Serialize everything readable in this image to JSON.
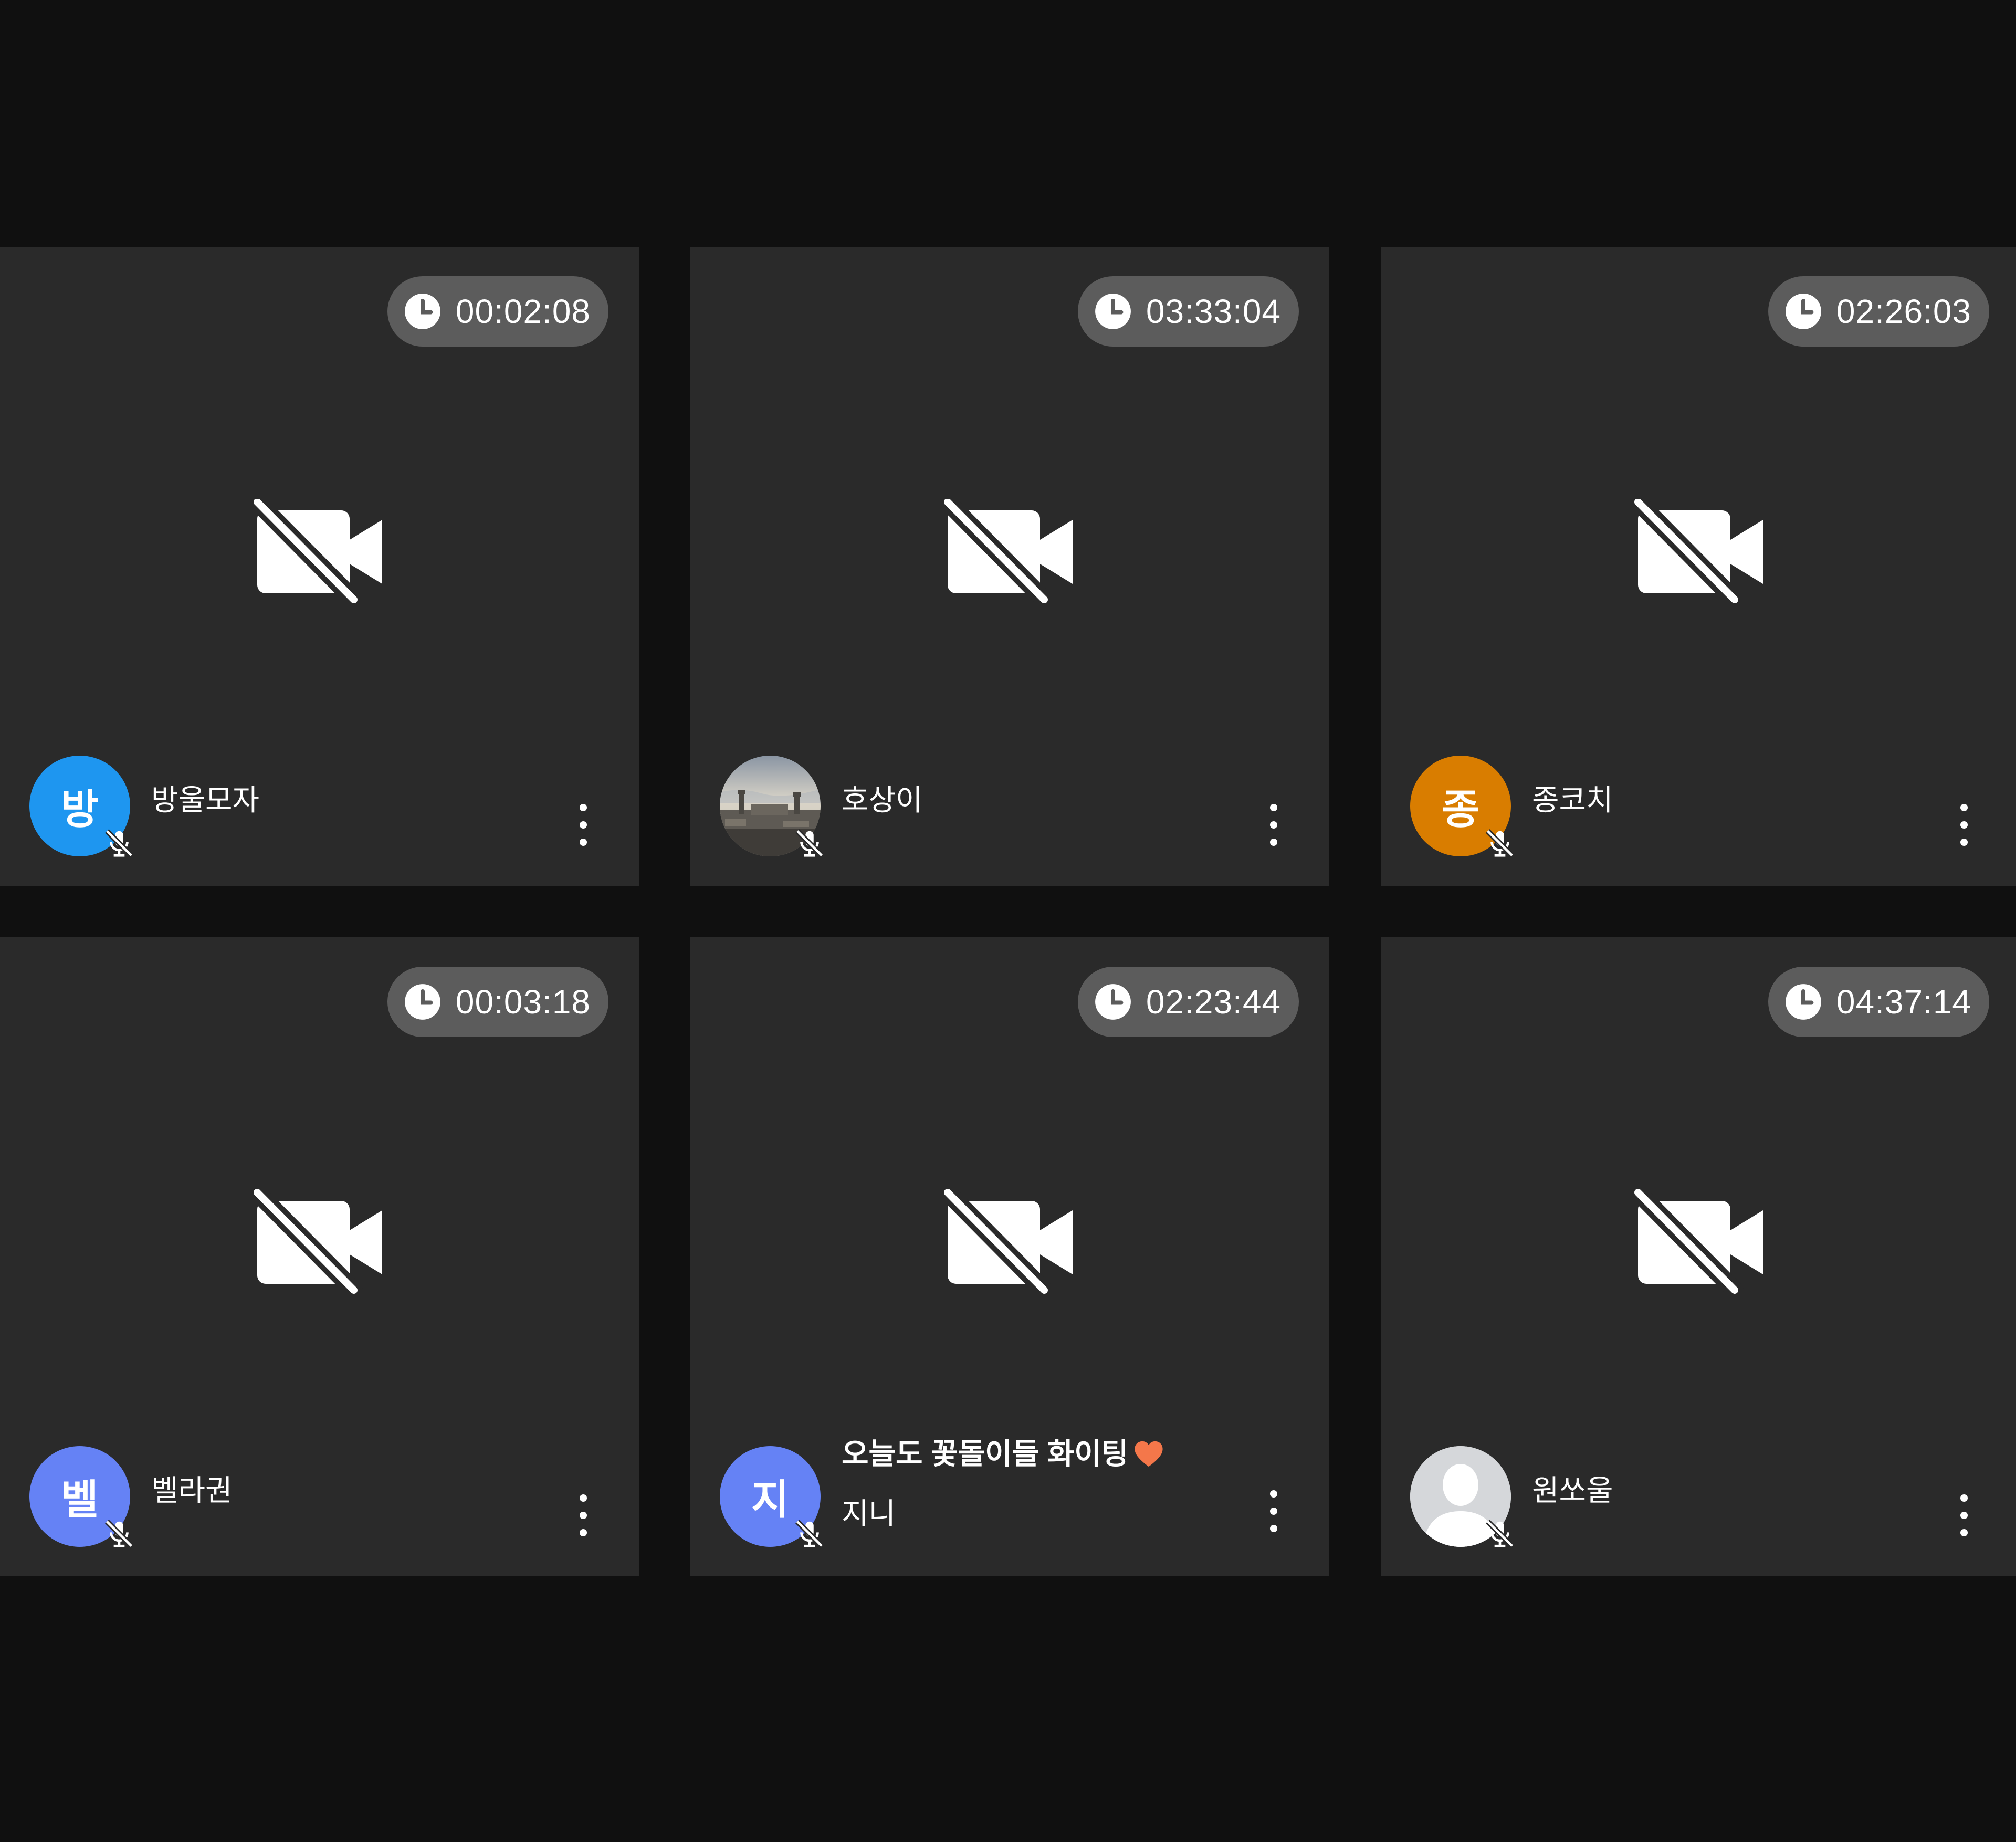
{
  "tiles": [
    {
      "timer": "00:02:08",
      "avatar_text": "방",
      "avatar_color": "#1e96f0",
      "name": "방울모자",
      "status": ""
    },
    {
      "timer": "03:33:04",
      "avatar_text": "",
      "avatar_kind": "photo-cityscape",
      "name": "호상이",
      "status": ""
    },
    {
      "timer": "02:26:03",
      "avatar_text": "종",
      "avatar_color": "#d97d00",
      "name": "종코치",
      "status": ""
    },
    {
      "timer": "00:03:18",
      "avatar_text": "벨",
      "avatar_color": "#6582f5",
      "name": "벨라권",
      "status": ""
    },
    {
      "timer": "02:23:44",
      "avatar_text": "지",
      "avatar_color": "#6582f5",
      "name": "지니",
      "status": "오늘도 꽃돌이들 화이팅"
    },
    {
      "timer": "04:37:14",
      "avatar_text": "",
      "avatar_kind": "default-person",
      "name": "원쏘울",
      "status": ""
    }
  ],
  "icons": {
    "timer": "clock-icon",
    "camera": "video-off-icon",
    "mic": "mic-off-icon",
    "menu": "more-vertical-icon",
    "status_emoji": "orange-heart-icon"
  },
  "colors": {
    "page_bg": "#101010",
    "tile_bg": "#2a2a2a",
    "timer_bg": "#5c5c5c",
    "heart": "#f4774a"
  }
}
